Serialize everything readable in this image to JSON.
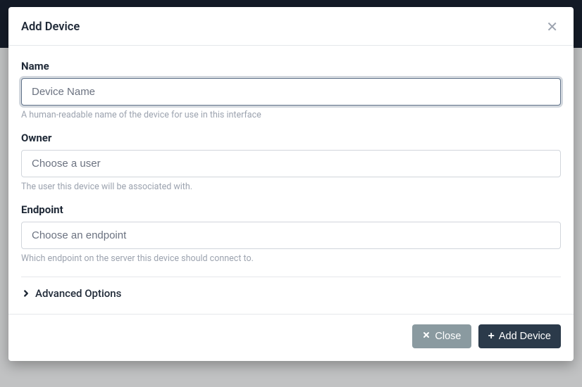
{
  "modal": {
    "title": "Add Device",
    "fields": {
      "name": {
        "label": "Name",
        "placeholder": "Device Name",
        "help": "A human-readable name of the device for use in this interface"
      },
      "owner": {
        "label": "Owner",
        "placeholder": "Choose a user",
        "help": "The user this device will be associated with."
      },
      "endpoint": {
        "label": "Endpoint",
        "placeholder": "Choose an endpoint",
        "help": "Which endpoint on the server this device should connect to."
      }
    },
    "advanced_label": "Advanced Options",
    "footer": {
      "close": "Close",
      "submit": "Add Device"
    }
  }
}
